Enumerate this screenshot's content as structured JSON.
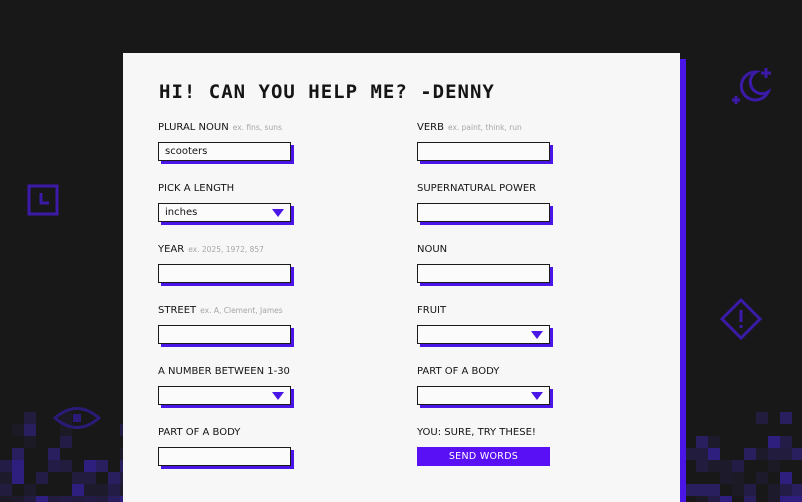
{
  "title": "HI! CAN YOU HELP ME? -DENNY",
  "fields_left": [
    {
      "label": "PLURAL NOUN",
      "hint": "ex. fins, suns",
      "value": "scooters",
      "type": "text"
    },
    {
      "label": "PICK A LENGTH",
      "hint": "",
      "value": "inches",
      "type": "select"
    },
    {
      "label": "YEAR",
      "hint": "ex. 2025, 1972, 857",
      "value": "",
      "type": "text"
    },
    {
      "label": "STREET",
      "hint": "ex. A, Clement, James",
      "value": "",
      "type": "text"
    },
    {
      "label": "A NUMBER BETWEEN 1-30",
      "hint": "",
      "value": "",
      "type": "select"
    },
    {
      "label": "PART OF A BODY",
      "hint": "",
      "value": "",
      "type": "text"
    }
  ],
  "fields_right": [
    {
      "label": "VERB",
      "hint": "ex. paint, think, run",
      "value": "",
      "type": "text"
    },
    {
      "label": "SUPERNATURAL POWER",
      "hint": "",
      "value": "",
      "type": "text"
    },
    {
      "label": "NOUN",
      "hint": "",
      "value": "",
      "type": "text"
    },
    {
      "label": "FRUIT",
      "hint": "",
      "value": "",
      "type": "select"
    },
    {
      "label": "PART OF A BODY",
      "hint": "",
      "value": "",
      "type": "select"
    }
  ],
  "submit": {
    "label": "YOU: SURE, TRY THESE!",
    "button": "SEND WORDS"
  },
  "colors": {
    "accent": "#4a16e8",
    "background": "#181818",
    "card": "#f7f7f7"
  },
  "icons": [
    "moon-stars-icon",
    "clock-icon",
    "warning-diamond-icon",
    "eye-icon"
  ]
}
